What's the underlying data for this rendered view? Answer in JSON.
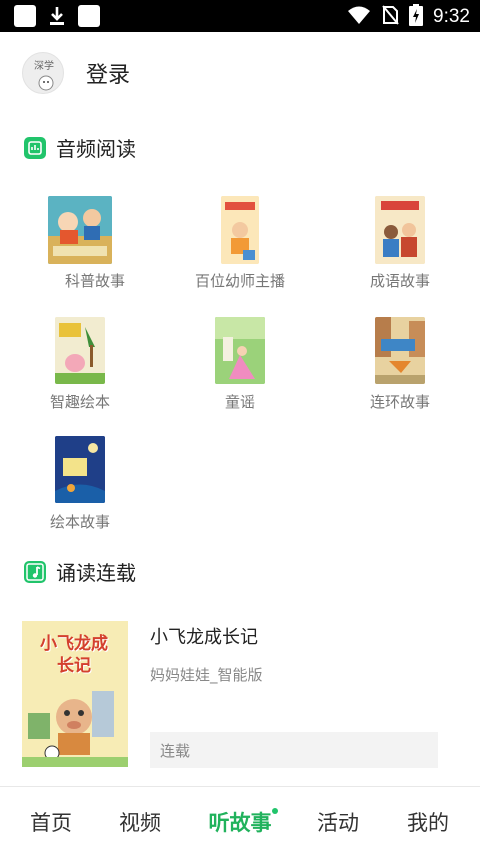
{
  "status_bar": {
    "time": "9:32",
    "icons": [
      "app-square-icon",
      "download-icon",
      "app-square-icon",
      "wifi-icon",
      "no-sim-icon",
      "battery-charging-icon"
    ]
  },
  "header": {
    "avatar_text": "深学",
    "login_label": "登录"
  },
  "audio_section": {
    "title": "音频阅读",
    "icon": "audio-book-icon",
    "items": [
      {
        "label": "科普故事"
      },
      {
        "label": "百位幼师主播"
      },
      {
        "label": "成语故事"
      },
      {
        "label": "智趣绘本"
      },
      {
        "label": "童谣"
      },
      {
        "label": "连环故事"
      },
      {
        "label": "绘本故事"
      }
    ]
  },
  "serial_section": {
    "title": "诵读连载",
    "icon": "music-note-icon",
    "items": [
      {
        "cover_text": "小飞龙成长记",
        "title": "小飞龙成长记",
        "subtitle": "妈妈娃娃_智能版",
        "tag": "连载"
      }
    ]
  },
  "bottom_nav": {
    "items": [
      {
        "label": "首页",
        "active": false
      },
      {
        "label": "视频",
        "active": false
      },
      {
        "label": "听故事",
        "active": true
      },
      {
        "label": "活动",
        "active": false
      },
      {
        "label": "我的",
        "active": false
      }
    ]
  },
  "colors": {
    "accent": "#21b25c",
    "status_bar": "#000000",
    "label_gray": "#777777"
  }
}
